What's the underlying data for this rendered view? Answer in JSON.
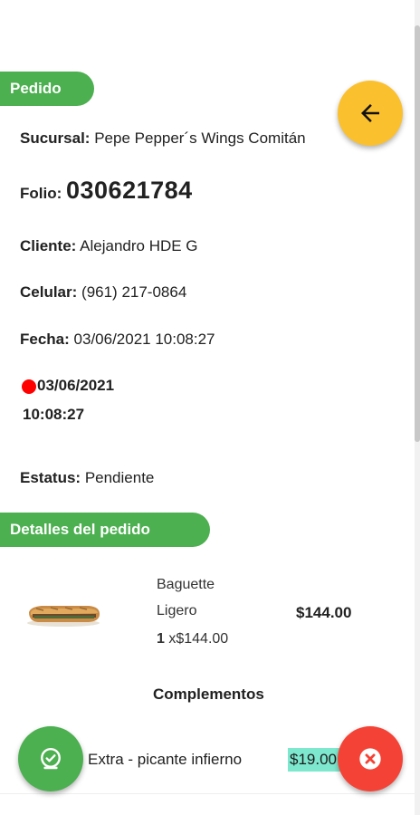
{
  "sections": {
    "pedido_title": "Pedido",
    "detalles_title": "Detalles del pedido"
  },
  "order": {
    "sucursal_label": "Sucursal:",
    "sucursal_value": "Pepe Pepper´s Wings Comitán",
    "folio_label": "Folio:",
    "folio_value": "030621784",
    "cliente_label": "Cliente:",
    "cliente_value": "Alejandro HDE G",
    "celular_label": "Celular:",
    "celular_value": "(961) 217-0864",
    "fecha_label": "Fecha:",
    "fecha_value": "03/06/2021 10:08:27",
    "deadline_date": "03/06/2021",
    "deadline_time": "10:08:27",
    "estatus_label": "Estatus:",
    "estatus_value": "Pendiente"
  },
  "product": {
    "name": "Baguette",
    "variant": "Ligero",
    "qty": "1",
    "unit_price": "x$144.00",
    "total": "$144.00"
  },
  "complementos": {
    "title": "Complementos",
    "items": [
      {
        "name": "Extra - picante infierno",
        "price": "$19.00"
      }
    ]
  },
  "buttons": {
    "back_icon": "arrow-left-icon",
    "ok_icon": "check-badge-icon",
    "cancel_icon": "close-circle-icon"
  },
  "colors": {
    "green": "#4caf50",
    "yellow": "#fbc02d",
    "red": "#f44336",
    "dot_red": "#ff0000",
    "price_highlight": "#7ee8cf"
  }
}
